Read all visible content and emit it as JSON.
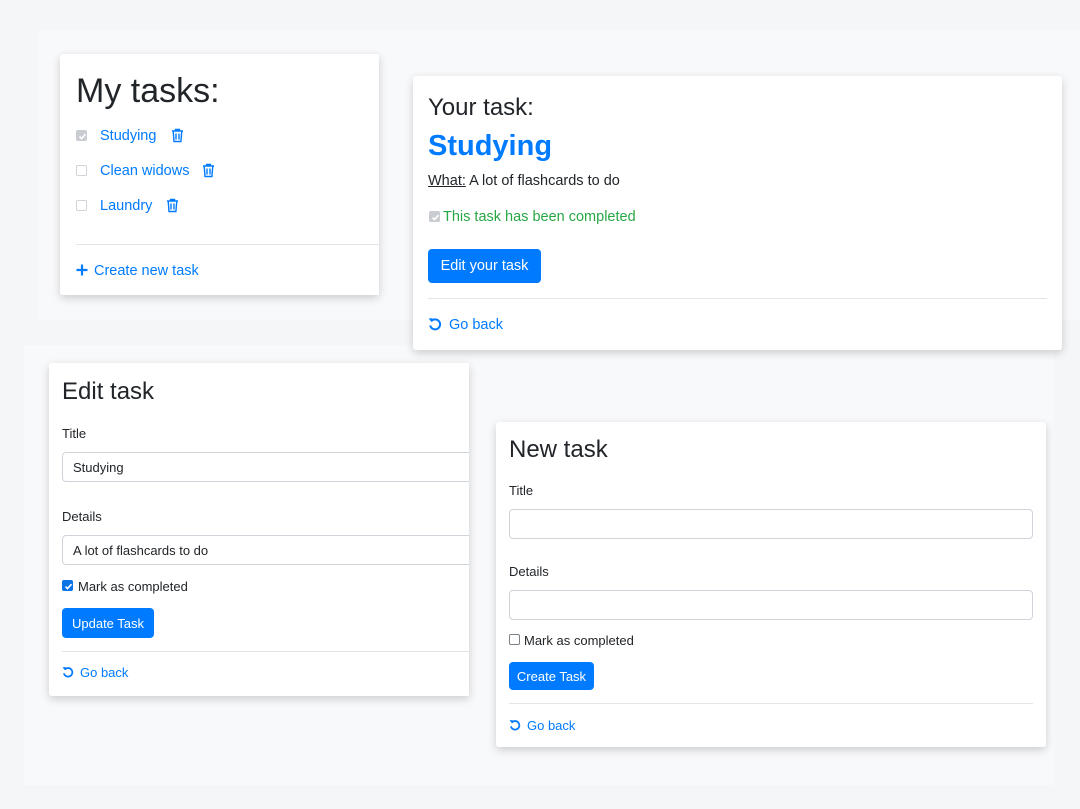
{
  "task_list": {
    "heading": "My tasks:",
    "tasks": [
      {
        "title": "Studying",
        "completed": true
      },
      {
        "title": "Clean widows",
        "completed": false
      },
      {
        "title": "Laundry",
        "completed": false
      }
    ],
    "create_link": "Create new task"
  },
  "task_detail": {
    "prefix": "Your task:",
    "title": "Studying",
    "what_label": "What:",
    "what_value": "A lot of flashcards to do",
    "completed_text": "This task has been completed",
    "edit_button": "Edit your task",
    "back_link": "Go back"
  },
  "edit_task": {
    "heading": "Edit task",
    "title_label": "Title",
    "title_value": "Studying",
    "details_label": "Details",
    "details_value": "A lot of flashcards to do",
    "completed_label": "Mark as completed",
    "completed": true,
    "submit_button": "Update Task",
    "back_link": "Go back"
  },
  "new_task": {
    "heading": "New task",
    "title_label": "Title",
    "title_value": "",
    "details_label": "Details",
    "details_value": "",
    "completed_label": "Mark as completed",
    "completed": false,
    "submit_button": "Create Task",
    "back_link": "Go back"
  },
  "colors": {
    "accent": "#007bff",
    "success": "#28a745",
    "text": "#212529"
  }
}
